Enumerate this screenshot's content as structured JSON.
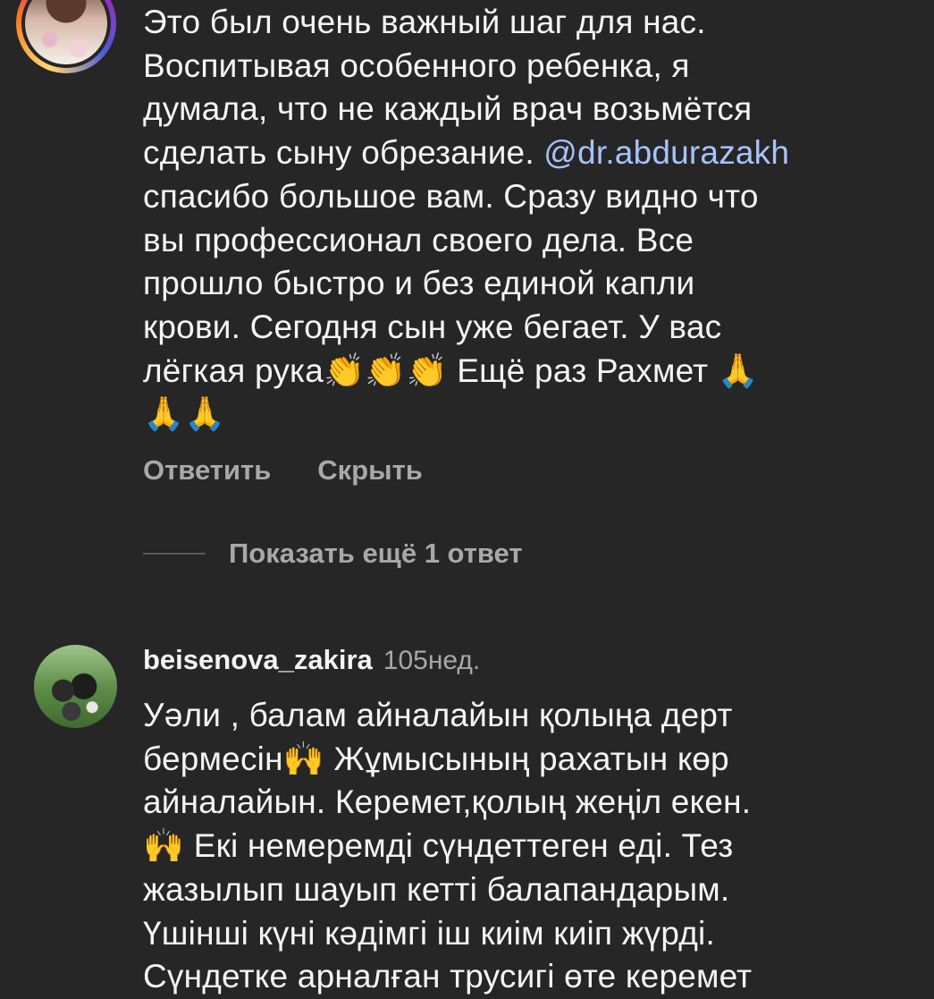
{
  "comments": [
    {
      "text_before_mention": "Это был очень важный шаг для нас.\nВоспитывая особенного ребенка, я\nдумала, что не каждый врач возьмётся\nсделать сыну обрезание. ",
      "mention": "@dr.abdurazakh",
      "text_after_mention": "\nспасибо большое вам. Сразу видно что\nвы профессионал своего дела. Все\nпрошло  быстро и без единой капли\nкрови. Сегодня сын уже бегает. У вас\nлёгкая рука👏👏👏 Ещё раз Рахмет 🙏\n🙏🙏",
      "actions": {
        "reply": "Ответить",
        "hide": "Скрыть"
      },
      "more_replies": "Показать ещё 1 ответ"
    },
    {
      "username": "beisenova_zakira",
      "time": "105нед.",
      "text": "Уәли , балам айналайын қолыңа дерт\nбермесін🙌  Жұмысының рахатын көр\nайналайын.  Керемет,қолың жеңіл екен.\n🙌 Екі немеремді сүндеттеген еді. Тез\nжазылып шауып кетті балапандарым.\nҮшінші күні кәдімгі іш киім киіп жүрді.\nСүндетке арналған трусигі өте керемет"
    }
  ]
}
